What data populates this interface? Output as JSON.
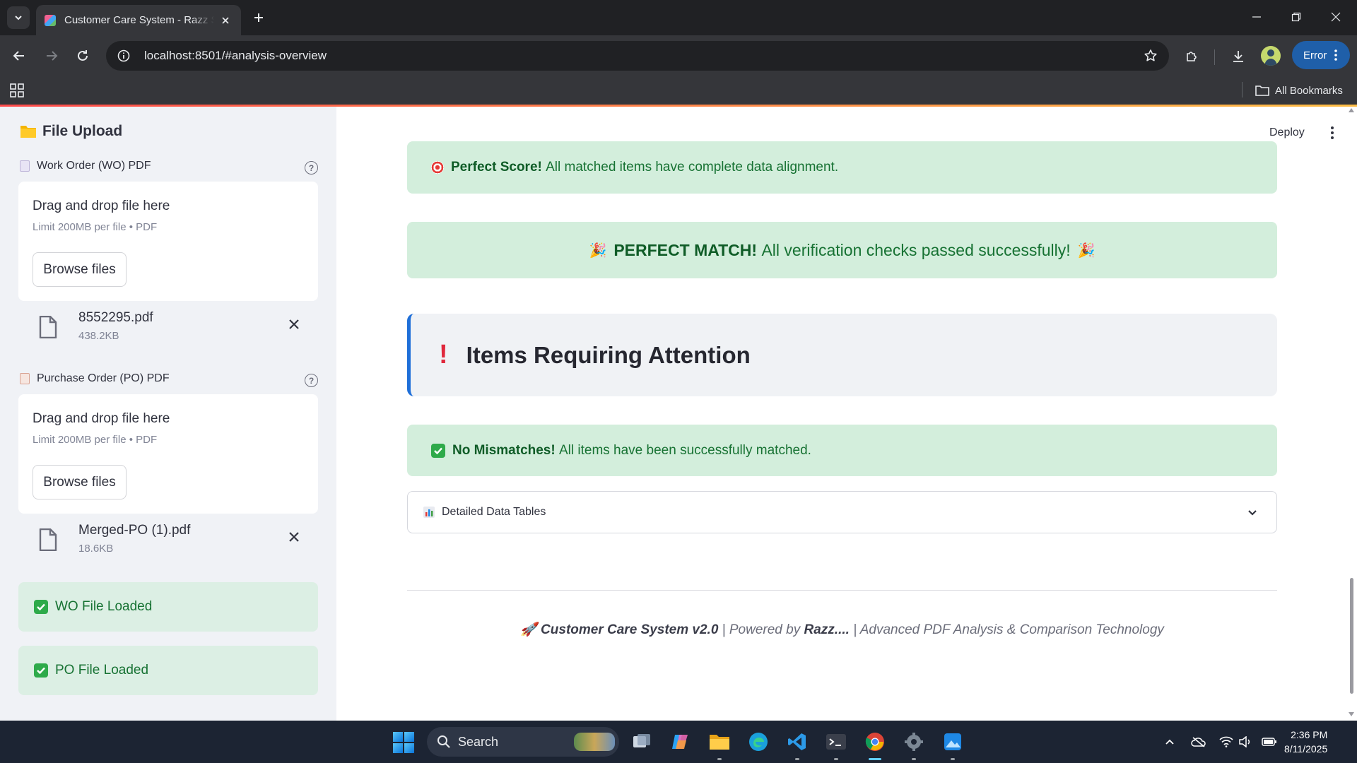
{
  "browser": {
    "tab_title": "Customer Care System - Razz Streamlit",
    "url": "localhost:8501/#analysis-overview",
    "profile_button": "Error",
    "bookmarks_label": "All Bookmarks"
  },
  "sidebar": {
    "title": "File Upload",
    "uploads": [
      {
        "label": "Work Order (WO) PDF",
        "drop_text": "Drag and drop file here",
        "limit_text": "Limit 200MB per file • PDF",
        "browse_label": "Browse files",
        "file_name": "8552295.pdf",
        "file_size": "438.2KB"
      },
      {
        "label": "Purchase Order (PO) PDF",
        "drop_text": "Drag and drop file here",
        "limit_text": "Limit 200MB per file • PDF",
        "browse_label": "Browse files",
        "file_name": "Merged-PO (1).pdf",
        "file_size": "18.6KB"
      }
    ],
    "status": [
      "WO File Loaded",
      "PO File Loaded"
    ]
  },
  "header": {
    "deploy_label": "Deploy"
  },
  "main": {
    "perfect_score": {
      "bold": "Perfect Score!",
      "text": "All matched items have complete data alignment."
    },
    "perfect_match": {
      "bold": "PERFECT MATCH!",
      "text": "All verification checks passed successfully!"
    },
    "attention_title": "Items Requiring Attention",
    "no_mismatch": {
      "bold": "No Mismatches!",
      "text": "All items have been successfully matched."
    },
    "expander_label": "Detailed Data Tables",
    "footer": {
      "app": "Customer Care System v2.0",
      "powered_prefix": "| Powered by",
      "author": "Razz....",
      "tagline": "| Advanced PDF Analysis & Comparison Technology"
    }
  },
  "taskbar": {
    "search_placeholder": "Search",
    "time": "2:36 PM",
    "date": "8/11/2025"
  },
  "colors": {
    "success_bg": "#d3eedc",
    "success_text": "#177233",
    "accent_blue": "#1f6fd8",
    "alert_red": "#e0283c"
  }
}
